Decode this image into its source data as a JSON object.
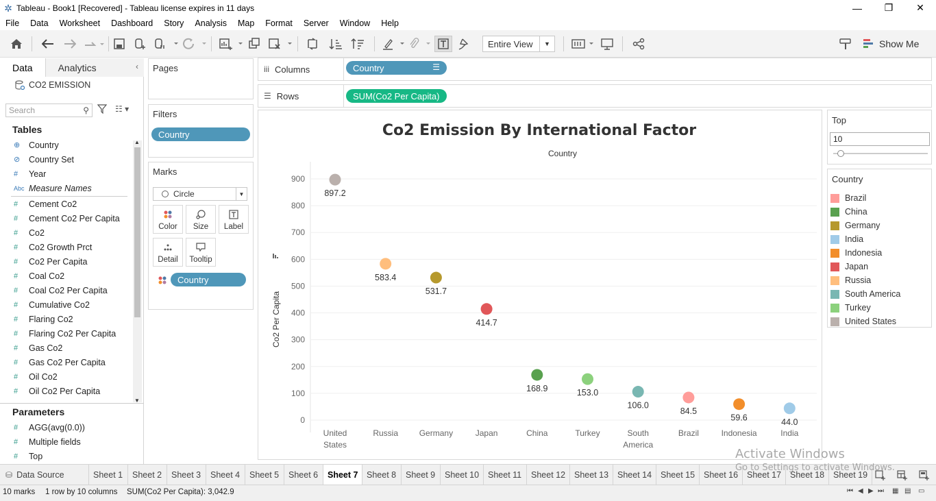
{
  "window": {
    "title": "Tableau - Book1 [Recovered] - Tableau license expires in 11 days",
    "min": "—",
    "max": "❐",
    "close": "✕"
  },
  "menu": [
    "File",
    "Data",
    "Worksheet",
    "Dashboard",
    "Story",
    "Analysis",
    "Map",
    "Format",
    "Server",
    "Window",
    "Help"
  ],
  "toolbar": {
    "view_mode": "Entire View",
    "show_me": "Show Me"
  },
  "data_pane": {
    "tab_data": "Data",
    "tab_analytics": "Analytics",
    "datasource": "CO2 EMISSION",
    "search_placeholder": "Search",
    "tables_header": "Tables",
    "fields": [
      {
        "icon": "⊕",
        "name": "Country",
        "kind": "dim"
      },
      {
        "icon": "⊘",
        "name": "Country Set",
        "kind": "dim"
      },
      {
        "icon": "#",
        "name": "Year",
        "kind": "dim"
      },
      {
        "icon": "Abc",
        "name": "Measure Names",
        "kind": "dim"
      },
      {
        "icon": "#",
        "name": "Cement Co2",
        "kind": "mea"
      },
      {
        "icon": "#",
        "name": "Cement Co2 Per Capita",
        "kind": "mea"
      },
      {
        "icon": "#",
        "name": "Co2",
        "kind": "mea"
      },
      {
        "icon": "#",
        "name": "Co2 Growth Prct",
        "kind": "mea"
      },
      {
        "icon": "#",
        "name": "Co2 Per Capita",
        "kind": "mea"
      },
      {
        "icon": "#",
        "name": "Coal Co2",
        "kind": "mea"
      },
      {
        "icon": "#",
        "name": "Coal Co2 Per Capita",
        "kind": "mea"
      },
      {
        "icon": "#",
        "name": "Cumulative Co2",
        "kind": "mea"
      },
      {
        "icon": "#",
        "name": "Flaring Co2",
        "kind": "mea"
      },
      {
        "icon": "#",
        "name": "Flaring Co2 Per Capita",
        "kind": "mea"
      },
      {
        "icon": "#",
        "name": "Gas Co2",
        "kind": "mea"
      },
      {
        "icon": "#",
        "name": "Gas Co2 Per Capita",
        "kind": "mea"
      },
      {
        "icon": "#",
        "name": "Oil Co2",
        "kind": "mea"
      },
      {
        "icon": "#",
        "name": "Oil Co2 Per Capita",
        "kind": "mea"
      }
    ],
    "parameters_header": "Parameters",
    "parameters": [
      {
        "icon": "#",
        "name": "AGG(avg(0.0))"
      },
      {
        "icon": "#",
        "name": "Multiple fields"
      },
      {
        "icon": "#",
        "name": "Top"
      }
    ]
  },
  "cards": {
    "pages": "Pages",
    "filters": "Filters",
    "filter_pill": "Country",
    "marks": "Marks",
    "mark_type": "Circle",
    "mark_buttons": [
      "Color",
      "Size",
      "Label",
      "Detail",
      "Tooltip"
    ],
    "marks_pill": "Country"
  },
  "shelves": {
    "columns_label": "Columns",
    "columns_pill": "Country",
    "rows_label": "Rows",
    "rows_pill": "SUM(Co2 Per Capita)"
  },
  "chart_data": {
    "type": "scatter",
    "title": "Co2 Emission By International Factor",
    "xlabel": "Country",
    "ylabel": "Co2 Per Capita",
    "ylim": [
      0,
      900
    ],
    "yticks": [
      0,
      100,
      200,
      300,
      400,
      500,
      600,
      700,
      800,
      900
    ],
    "grid": true,
    "categories": [
      "United States",
      "Russia",
      "Germany",
      "Japan",
      "China",
      "Turkey",
      "South America",
      "Brazil",
      "Indonesia",
      "India"
    ],
    "values": [
      897.2,
      583.4,
      531.7,
      414.7,
      168.9,
      153.0,
      106.0,
      84.5,
      59.6,
      44.0
    ],
    "labels": [
      "897.2",
      "583.4",
      "531.7",
      "414.7",
      "168.9",
      "153.0",
      "106.0",
      "84.5",
      "59.6",
      "44.0"
    ],
    "colors": [
      "#bab0ac",
      "#ffbe7d",
      "#b6992d",
      "#e15759",
      "#59a14f",
      "#8cd17d",
      "#79b7b2",
      "#ff9d9a",
      "#f28e2b",
      "#a0cbe8"
    ]
  },
  "right_pane": {
    "top_label": "Top",
    "top_value": "10",
    "legend_title": "Country",
    "legend": [
      {
        "name": "Brazil",
        "color": "#ff9d9a"
      },
      {
        "name": "China",
        "color": "#59a14f"
      },
      {
        "name": "Germany",
        "color": "#b6992d"
      },
      {
        "name": "India",
        "color": "#a0cbe8"
      },
      {
        "name": "Indonesia",
        "color": "#f28e2b"
      },
      {
        "name": "Japan",
        "color": "#e15759"
      },
      {
        "name": "Russia",
        "color": "#ffbe7d"
      },
      {
        "name": "South America",
        "color": "#79b7b2"
      },
      {
        "name": "Turkey",
        "color": "#8cd17d"
      },
      {
        "name": "United States",
        "color": "#bab0ac"
      }
    ]
  },
  "sheet_tabs": {
    "data_source": "Data Source",
    "sheets": [
      "Sheet 1",
      "Sheet 2",
      "Sheet 3",
      "Sheet 4",
      "Sheet 5",
      "Sheet 6",
      "Sheet 7",
      "Sheet 8",
      "Sheet 9",
      "Sheet 10",
      "Sheet 11",
      "Sheet 12",
      "Sheet 13",
      "Sheet 14",
      "Sheet 15",
      "Sheet 16",
      "Sheet 17",
      "Sheet 18",
      "Sheet 19"
    ],
    "active": "Sheet 7"
  },
  "status": {
    "marks": "10 marks",
    "rows_cols": "1 row by 10 columns",
    "sum": "SUM(Co2 Per Capita): 3,042.9"
  },
  "watermark": {
    "line1": "Activate Windows",
    "line2": "Go to Settings to activate Windows."
  }
}
